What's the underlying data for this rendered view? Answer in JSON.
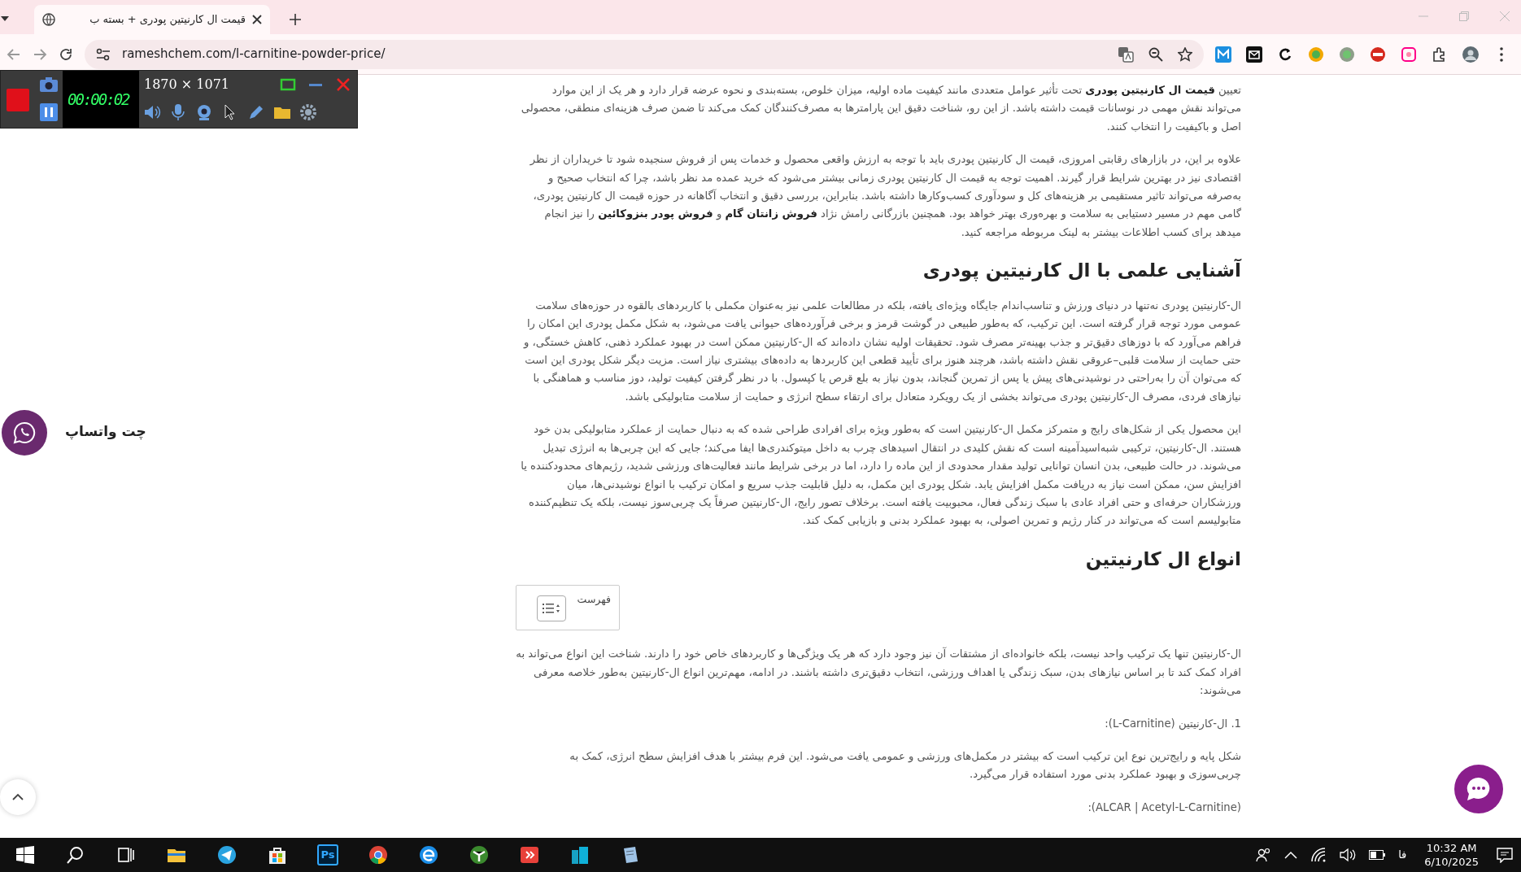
{
  "browser": {
    "tab_title": "قیمت ال کارنیتین پودری + بسته ب",
    "url": "rameshchem.com/l-carnitine-powder-price/"
  },
  "recorder": {
    "resolution": "1870 × 1071",
    "timer": "00:00:02"
  },
  "article": {
    "blocks": [
      {
        "kind": "paragraph",
        "text": "تعیین **قیمت ال کارنیتین پودری** تحت تأثیر عوامل متعددی مانند کیفیت ماده اولیه، میزان خلوص، بسته‌بندی و نحوه عرضه قرار دارد و هر یک از این موارد می‌تواند نقش مهمی در نوسانات قیمت داشته باشد. از این رو، شناخت دقیق این پارامترها به مصرف‌کنندگان کمک می‌کند تا ضمن صرف هزینه‌ای منطقی، محصولی اصل و باکیفیت را انتخاب کنند."
      },
      {
        "kind": "paragraph",
        "text": "علاوه بر این، در بازارهای رقابتی امروزی، قیمت ال کارنیتین پودری باید با توجه به ارزش واقعی محصول و خدمات پس از فروش سنجیده شود تا خریداران از نظر اقتصادی نیز در بهترین شرایط قرار گیرند. اهمیت توجه به قیمت ال کارنیتین پودری زمانی بیشتر می‌شود که خرید عمده مد نظر باشد، چرا که انتخاب صحیح و به‌صرفه می‌تواند تاثیر مستقیمی بر هزینه‌های کل و سودآوری کسب‌وکارها داشته باشد. بنابراین، بررسی دقیق و انتخاب آگاهانه در حوزه قیمت ال کارنیتین پودری، گامی مهم در مسیر دستیابی به سلامت و بهره‌وری بهتر خواهد بود. همچنین بازرگانی رامش نژاد **فروش زانتان گام** و **فروش پودر بنزوکائین** را نیز انجام میدهد برای کسب اطلاعات بیشتر به لینک مربوطه مراجعه کنید."
      },
      {
        "kind": "heading",
        "text": "آشنایی علمی با ال کارنیتین پودری"
      },
      {
        "kind": "paragraph",
        "text": "ال-کارنیتین پودری نه‌تنها در دنیای ورزش و تناسب‌اندام جایگاه ویژه‌ای یافته، بلکه در مطالعات علمی نیز به‌عنوان مکملی با کاربردهای بالقوه در حوزه‌های سلامت عمومی مورد توجه قرار گرفته است. این ترکیب، که به‌طور طبیعی در گوشت قرمز و برخی فرآورده‌های حیوانی یافت می‌شود، به شکل مکمل پودری این امکان را فراهم می‌آورد که با دوزهای دقیق‌تر و جذب بهینه‌تر مصرف شود. تحقیقات اولیه نشان داده‌اند که ال-کارنیتین ممکن است در بهبود عملکرد ذهنی، کاهش خستگی، و حتی حمایت از سلامت قلبی–عروقی نقش داشته باشد، هرچند هنوز برای تأیید قطعی این کاربردها به داده‌های بیشتری نیاز است. مزیت دیگر شکل پودری این است که می‌توان آن را به‌راحتی در نوشیدنی‌های پیش یا پس از تمرین گنجاند، بدون نیاز به بلع قرص یا کپسول. با در نظر گرفتن کیفیت تولید، دوز مناسب و هماهنگی با نیازهای فردی، مصرف ال-کارنیتین پودری می‌تواند بخشی از یک رویکرد متعادل برای ارتقاء سطح انرژی و حمایت از سلامت متابولیکی باشد."
      },
      {
        "kind": "paragraph",
        "text": "این محصول یکی از شکل‌های رایج و متمرکز مکمل ال-کارنیتین است که به‌طور ویژه برای افرادی طراحی شده که به دنبال حمایت از عملکرد متابولیکی بدن خود هستند. ال-کارنیتین، ترکیبی شبه‌اسیدآمینه است که نقش کلیدی در انتقال اسیدهای چرب به داخل میتوکندری‌ها ایفا می‌کند؛ جایی که این چربی‌ها به انرژی تبدیل می‌شوند. در حالت طبیعی، بدن انسان توانایی تولید مقدار محدودی از این ماده را دارد، اما در برخی شرایط مانند فعالیت‌های ورزشی شدید، رژیم‌های محدودکننده یا افزایش سن، ممکن است نیاز به دریافت مکمل افزایش یابد. شکل پودری این مکمل، به دلیل قابلیت جذب سریع و امکان ترکیب با انواع نوشیدنی‌ها، میان ورزشکاران حرفه‌ای و حتی افراد عادی با سبک زندگی فعال، محبوبیت یافته است. برخلاف تصور رایج، ال-کارنیتین صرفاً یک چربی‌سوز نیست، بلکه یک تنظیم‌کننده متابولیسم است که می‌تواند در کنار رژیم و تمرین اصولی، به بهبود عملکرد بدنی و بازیابی کمک کند."
      },
      {
        "kind": "heading",
        "text": "انواع ال کارنیتین"
      },
      {
        "kind": "toc",
        "text": "فهرست"
      },
      {
        "kind": "paragraph",
        "text": "ال-کارنیتین تنها یک ترکیب واحد نیست، بلکه خانواده‌ای از مشتقات آن نیز وجود دارد که هر یک ویژگی‌ها و کاربردهای خاص خود را دارند. شناخت این انواع می‌تواند به افراد کمک کند تا بر اساس نیازهای بدن، سبک زندگی یا اهداف ورزشی، انتخاب دقیق‌تری داشته باشند. در ادامه، مهم‌ترین انواع ال-کارنیتین به‌طور خلاصه معرفی می‌شوند:"
      },
      {
        "kind": "paragraph",
        "text": "1. ال-کارنیتین (L-Carnitine):"
      },
      {
        "kind": "paragraph",
        "text": "شکل پایه و رایج‌ترین نوع این ترکیب است که بیشتر در مکمل‌های ورزشی و عمومی یافت می‌شود. این فرم بیشتر با هدف افزایش سطح انرژی، کمک به چربی‌سوزی و بهبود عملکرد بدنی مورد استفاده قرار می‌گیرد."
      },
      {
        "kind": "paragraph",
        "text": "(ALCAR | Acetyl-L-Carnitine):"
      }
    ]
  },
  "whatsapp": {
    "label": "چت واتساپ"
  },
  "taskbar": {
    "photoshop_label": "Ps",
    "input_language": "فا",
    "time": "10:32 AM",
    "date": "6/10/2025"
  }
}
